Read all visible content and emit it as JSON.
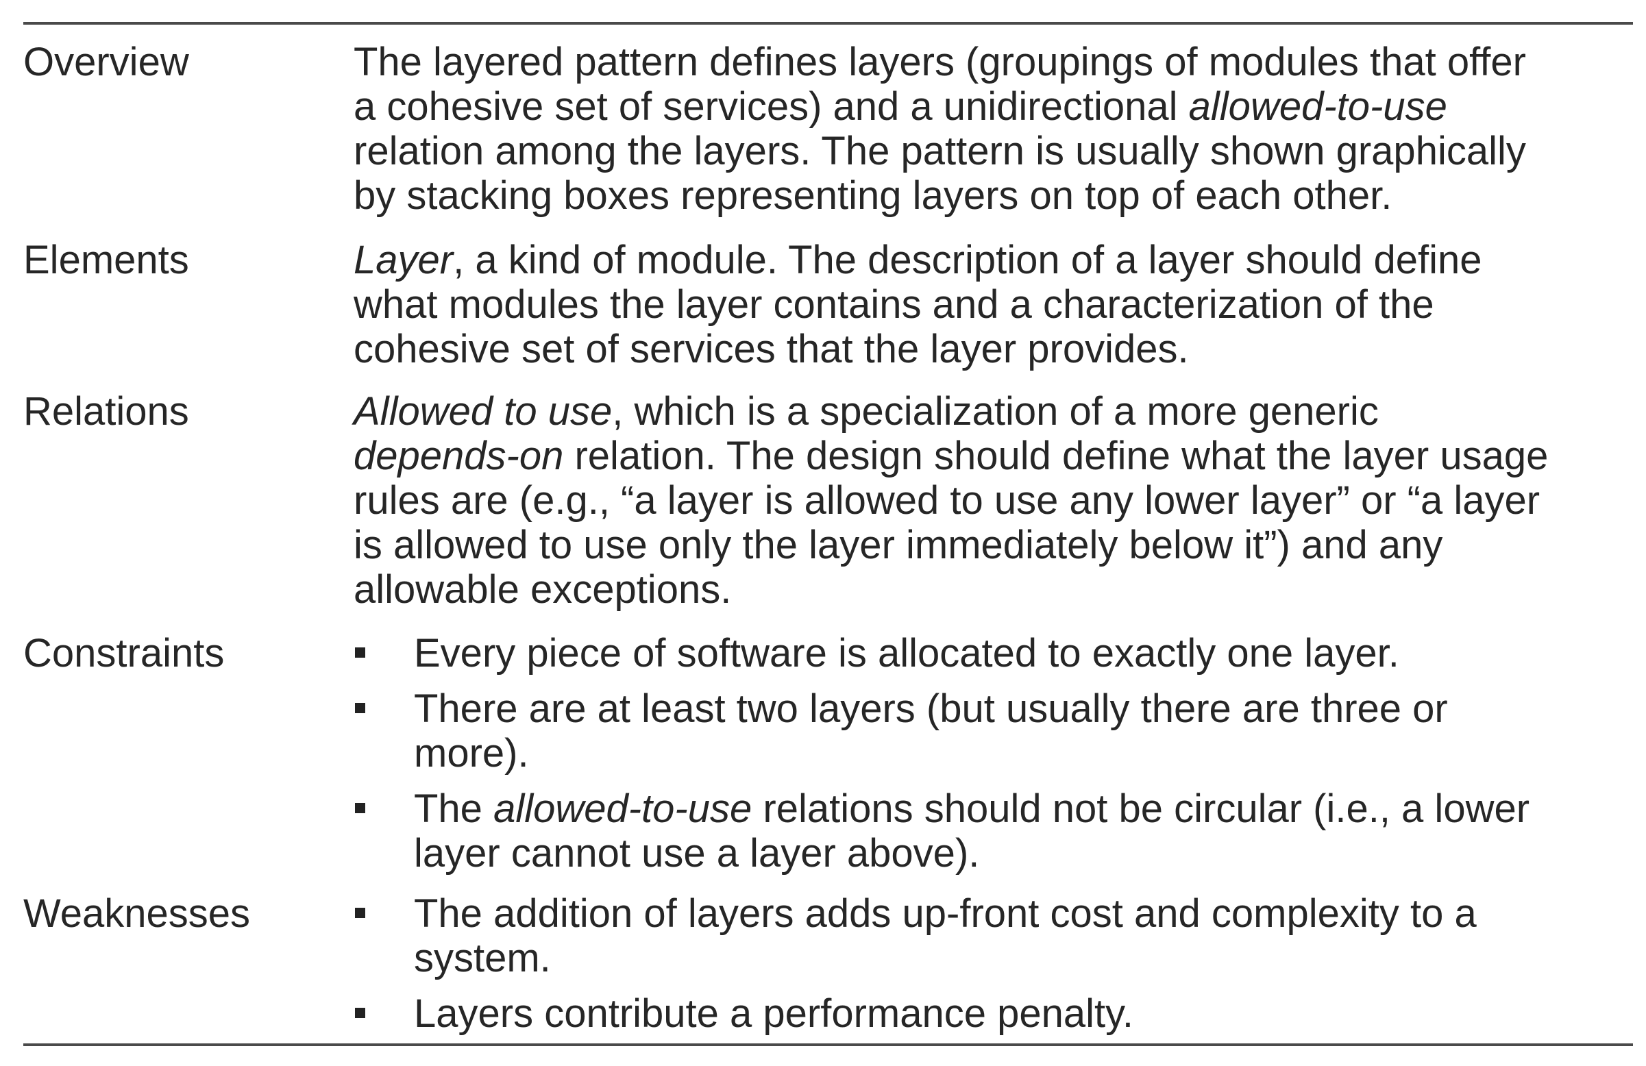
{
  "table": {
    "rows": [
      {
        "label": "Overview",
        "lines": [
          {
            "text": "The layered pattern defines layers (groupings of modules that offer"
          },
          {
            "a": "a cohesive set of services) and a unidirectional ",
            "b": "allowed-to-use",
            "c": ""
          },
          {
            "text": "relation among the layers. The pattern is usually shown graphically"
          },
          {
            "text": "by stacking boxes representing layers on top of each other."
          }
        ]
      },
      {
        "label": "Elements",
        "lines": [
          {
            "a": "",
            "b": "Layer",
            "c": ", a kind of module. The description of a layer should define"
          },
          {
            "text": "what modules the layer contains and a characterization of the"
          },
          {
            "text": "cohesive set of services that the layer provides."
          }
        ]
      },
      {
        "label": "Relations",
        "lines": [
          {
            "a": "",
            "b": "Allowed to use",
            "c": ", which is a specialization of a more generic"
          },
          {
            "a": "",
            "b": "depends-on",
            "c": " relation. The design should define what the layer usage"
          },
          {
            "text": "rules are (e.g., “a layer is allowed to use any lower layer” or “a layer"
          },
          {
            "text": "is allowed to use only the layer immediately below it”) and any"
          },
          {
            "text": "allowable exceptions."
          }
        ]
      },
      {
        "label": "Constraints",
        "bullets": [
          {
            "lines": [
              {
                "text": "Every piece of software is allocated to exactly one layer."
              }
            ]
          },
          {
            "lines": [
              {
                "text": "There are at least two layers (but usually there are three or"
              },
              {
                "text": "more)."
              }
            ]
          },
          {
            "lines": [
              {
                "a": "The ",
                "b": "allowed-to-use",
                "c": " relations should not be circular (i.e., a lower"
              },
              {
                "text": "layer cannot use a layer above)."
              }
            ]
          }
        ]
      },
      {
        "label": "Weaknesses",
        "bullets": [
          {
            "lines": [
              {
                "text": "The addition of layers adds up-front cost and complexity to a"
              },
              {
                "text": "system."
              }
            ]
          },
          {
            "lines": [
              {
                "text": "Layers contribute a performance penalty."
              }
            ]
          }
        ]
      }
    ]
  }
}
